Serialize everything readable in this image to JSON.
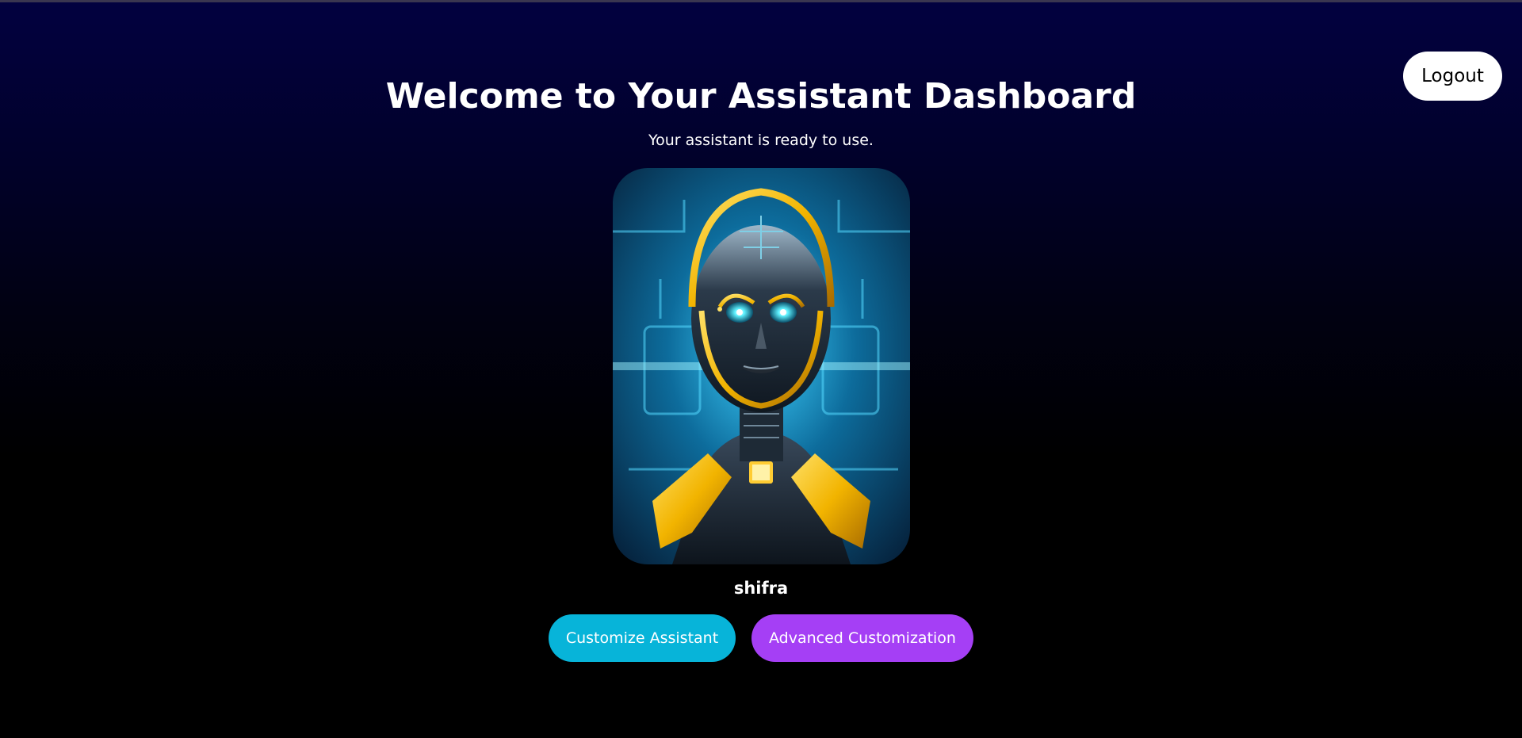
{
  "header": {
    "logout_label": "Logout"
  },
  "main": {
    "title": "Welcome to Your Assistant Dashboard",
    "subtitle": "Your assistant is ready to use.",
    "assistant_name": "shifra",
    "avatar_icon": "robot-avatar-image"
  },
  "actions": {
    "customize_label": "Customize Assistant",
    "advanced_label": "Advanced Customization"
  },
  "colors": {
    "background_top": "#020140",
    "background_bottom": "#000000",
    "customize_button": "#07b4d9",
    "advanced_button": "#a53ff5",
    "logout_button": "#ffffff"
  }
}
